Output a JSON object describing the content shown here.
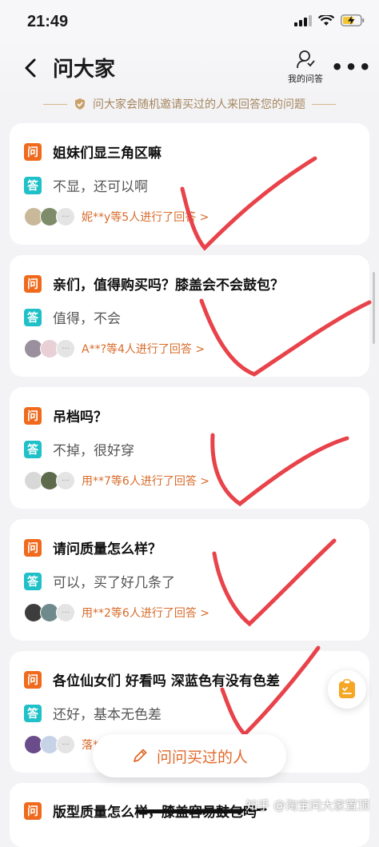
{
  "status": {
    "time": "21:49"
  },
  "header": {
    "title": "问大家",
    "my_questions": "我的问答"
  },
  "notice": "问大家会随机邀请买过的人来回答您的问题",
  "badges": {
    "q": "问",
    "a": "答"
  },
  "cards": [
    {
      "q": "姐妹们显三角区嘛",
      "a": "不显，还可以啊",
      "answerers": "妮**y等5人进行了回答 >"
    },
    {
      "q": "亲们，值得购买吗？膝盖会不会鼓包？",
      "a": "值得，不会",
      "answerers": "A**?等4人进行了回答 >"
    },
    {
      "q": "吊档吗？",
      "a": "不掉，很好穿",
      "answerers": "用**7等6人进行了回答 >"
    },
    {
      "q": "请问质量怎么样？",
      "a": "可以，买了好几条了",
      "answerers": "用**2等6人进行了回答 >"
    },
    {
      "q": "各位仙女们 好看吗 深蓝色有没有色差",
      "a": "还好，基本无色差",
      "answerers": "落**"
    },
    {
      "q": "版型质量怎么样，膝盖容易鼓包吗"
    }
  ],
  "ask_button": "问问买过的人",
  "watermark": "知乎 @淘宝问大家置顶",
  "colors": {
    "question_badge": "#f06a1d",
    "answer_badge": "#1fc0c8",
    "accent": "#e0692a",
    "check_mark": "#e8434a"
  }
}
